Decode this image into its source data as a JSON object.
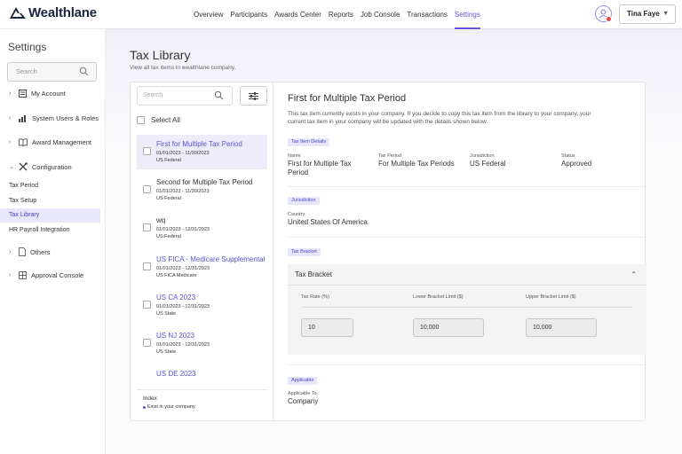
{
  "app": {
    "logo_text": "Wealthlane"
  },
  "nav": {
    "items": [
      "Overview",
      "Participants",
      "Awards Center",
      "Reports",
      "Job Console",
      "Transactions",
      "Settings"
    ],
    "active": "Settings"
  },
  "user": {
    "name": "Tina Faye"
  },
  "sidebar": {
    "title": "Settings",
    "search_placeholder": "Search",
    "items": [
      {
        "label": "My Account",
        "icon": "account-icon"
      },
      {
        "label": "System Users & Roles",
        "icon": "users-roles-icon"
      },
      {
        "label": "Award Management",
        "icon": "book-icon"
      },
      {
        "label": "Configuration",
        "icon": "tools-icon",
        "expanded": true
      }
    ],
    "config_sub": [
      "Tax Period",
      "Tax Setup",
      "Tax Library",
      "HR Payroll Integration"
    ],
    "active_sub": "Tax Library",
    "items_after": [
      {
        "label": "Others",
        "icon": "document-icon"
      },
      {
        "label": "Approval Console",
        "icon": "console-icon"
      }
    ]
  },
  "page": {
    "title": "Tax Library",
    "subtitle": "View all tax items in wealthlane company."
  },
  "list": {
    "search_placeholder": "Search",
    "select_all": "Select All",
    "items": [
      {
        "name": "First for Multiple Tax Period",
        "date": "01/01/2023 - 11/30/2023",
        "jurisdiction": "US Federal",
        "in_company": true,
        "selected": true
      },
      {
        "name": "Second for Multiple Tax Period",
        "date": "01/01/2023 - 11/30/2023",
        "jurisdiction": "US Federal",
        "in_company": false
      },
      {
        "name": "wq",
        "date": "01/01/2023 - 12/31/2023",
        "jurisdiction": "US Federal",
        "in_company": false
      },
      {
        "name": "US FICA - Medicare Supplemental",
        "date": "01/01/2023 - 12/31/2023",
        "jurisdiction": "US FICA Medicare",
        "in_company": true
      },
      {
        "name": "US CA 2023",
        "date": "01/01/2023 - 12/31/2023",
        "jurisdiction": "US State",
        "in_company": true
      },
      {
        "name": "US NJ 2023",
        "date": "01/01/2023 - 12/31/2023",
        "jurisdiction": "US State",
        "in_company": true
      },
      {
        "name": "US DE 2023",
        "date": "",
        "jurisdiction": "",
        "in_company": true
      }
    ],
    "index": {
      "title": "Index",
      "entry": "Exist in your company"
    }
  },
  "detail": {
    "title": "First for Multiple Tax Period",
    "description": "This tax item currently exists in your company. If you decide to copy this tax item from the library to your company, your current tax item in your company will be updated with the details shown below.",
    "tax_item_details": {
      "tag": "Tax Item Details",
      "fields": [
        {
          "label": "Name",
          "value": "First for Multiple Tax Period"
        },
        {
          "label": "Tax Period",
          "value": "For Multiple Tax Periods"
        },
        {
          "label": "Jurisdiction",
          "value": "US Federal"
        },
        {
          "label": "Status",
          "value": "Approved"
        }
      ]
    },
    "jurisdiction": {
      "tag": "Jurisdiction",
      "label": "Country",
      "value": "United States Of America"
    },
    "tax_bracket": {
      "tag": "Tax Bracket",
      "panel_title": "Tax Bracket",
      "columns": [
        "Tax Rate (%)",
        "Lower Bracket Limit ($)",
        "Upper Bracket Limit ($)"
      ],
      "values": [
        "10",
        "10,000",
        "10,000"
      ]
    },
    "applicable": {
      "tag": "Applicable",
      "label": "Applicable To",
      "value": "Company"
    }
  },
  "colors": {
    "accent": "#6a55d6",
    "link": "#5a52d6",
    "tag_bg": "#e8e6fb",
    "selected_bg": "#eeebfb"
  }
}
